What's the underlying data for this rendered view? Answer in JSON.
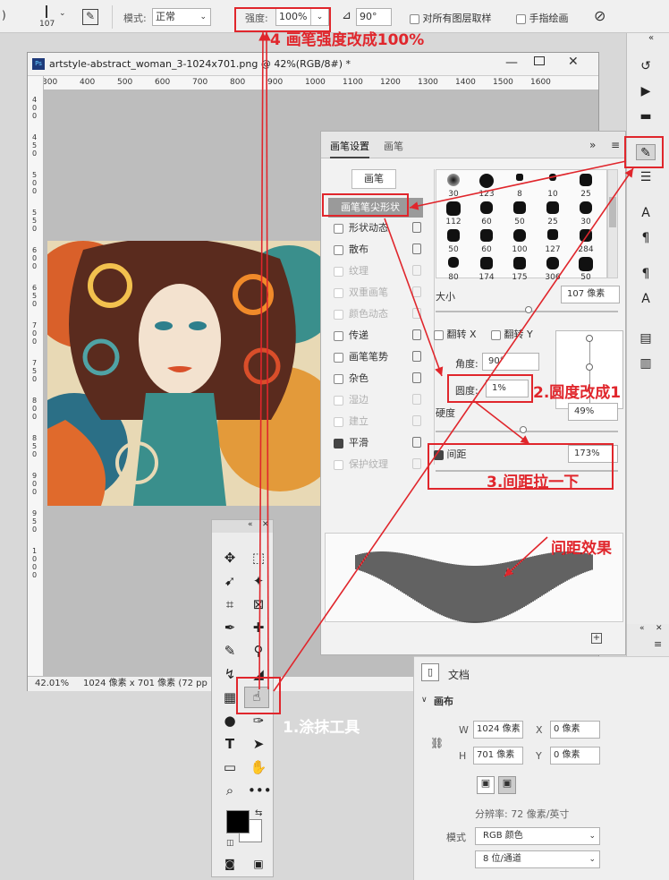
{
  "options_bar": {
    "brush_size": "107",
    "mode_label": "模式:",
    "mode_value": "正常",
    "strength_label": "强度:",
    "strength_value": "100%",
    "angle_value": "90°",
    "sample_all_layers": "对所有图层取样",
    "finger_painting": "手指绘画"
  },
  "document": {
    "title": "artstyle-abstract_woman_3-1024x701.png @ 42%(RGB/8#) *",
    "ruler_ticks": [
      "300",
      "400",
      "500",
      "600",
      "700",
      "800",
      "900",
      "1000",
      "1100",
      "1200",
      "1300",
      "1400",
      "1500",
      "1600"
    ],
    "vruler_ticks": [
      "4 0 0",
      "4 5 0",
      "5 0 0",
      "5 5 0",
      "6 0 0",
      "6 5 0",
      "7 0 0",
      "7 5 0",
      "8 0 0",
      "8 5 0",
      "9 0 0",
      "9 5 0",
      "1 0 0 0"
    ],
    "zoom": "42.01%",
    "doc_info": "1024 像素 x 701 像素 (72 pp"
  },
  "brush_panel": {
    "tab_settings": "画笔设置",
    "tab_brush": "画笔",
    "brushes_button": "画笔",
    "tip_shape": "画笔笔尖形状",
    "options": [
      {
        "label": "形状动态",
        "checked": false,
        "enabled": true
      },
      {
        "label": "散布",
        "checked": false,
        "enabled": true
      },
      {
        "label": "纹理",
        "checked": false,
        "enabled": false
      },
      {
        "label": "双重画笔",
        "checked": false,
        "enabled": false
      },
      {
        "label": "颜色动态",
        "checked": false,
        "enabled": false
      },
      {
        "label": "传递",
        "checked": false,
        "enabled": true
      },
      {
        "label": "画笔笔势",
        "checked": false,
        "enabled": true
      },
      {
        "label": "杂色",
        "checked": false,
        "enabled": true
      },
      {
        "label": "湿边",
        "checked": false,
        "enabled": false
      },
      {
        "label": "建立",
        "checked": false,
        "enabled": false
      },
      {
        "label": "平滑",
        "checked": true,
        "enabled": true
      },
      {
        "label": "保护纹理",
        "checked": false,
        "enabled": false
      }
    ],
    "tip_sizes": [
      "30",
      "123",
      "8",
      "10",
      "25",
      "112",
      "60",
      "50",
      "25",
      "30",
      "50",
      "60",
      "100",
      "127",
      "284",
      "80",
      "174",
      "175",
      "306",
      "50"
    ],
    "size_label": "大小",
    "size_value": "107 像素",
    "flip_x": "翻转 X",
    "flip_y": "翻转 Y",
    "angle_label": "角度:",
    "angle_value": "90°",
    "roundness_label": "圆度:",
    "roundness_value": "1%",
    "hardness_label": "硬度",
    "hardness_value": "49%",
    "spacing_label": "间距",
    "spacing_value": "173%"
  },
  "toolbox": {
    "foreground_color": "#000000",
    "background_color": "#ffffff"
  },
  "properties": {
    "doc_label": "文档",
    "canvas_label": "画布",
    "w_label": "W",
    "w_value": "1024 像素",
    "h_label": "H",
    "h_value": "701 像素",
    "x_label": "X",
    "x_value": "0 像素",
    "y_label": "Y",
    "y_value": "0 像素",
    "resolution": "分辨率: 72 像素/英寸",
    "mode_label": "模式",
    "mode_value": "RGB 颜色",
    "bit_depth": "8 位/通道"
  },
  "annotations": {
    "step1": "1.涂抹工具",
    "step2": "2.圆度改成1",
    "step3": "3.间距拉一下",
    "step4": "4 画笔强度改成100%",
    "effect": "间距效果"
  },
  "colors": {
    "annotation_red": "#e0262c",
    "panel_bg": "#f2f2f2",
    "canvas_bg": "#bdbdbd"
  }
}
